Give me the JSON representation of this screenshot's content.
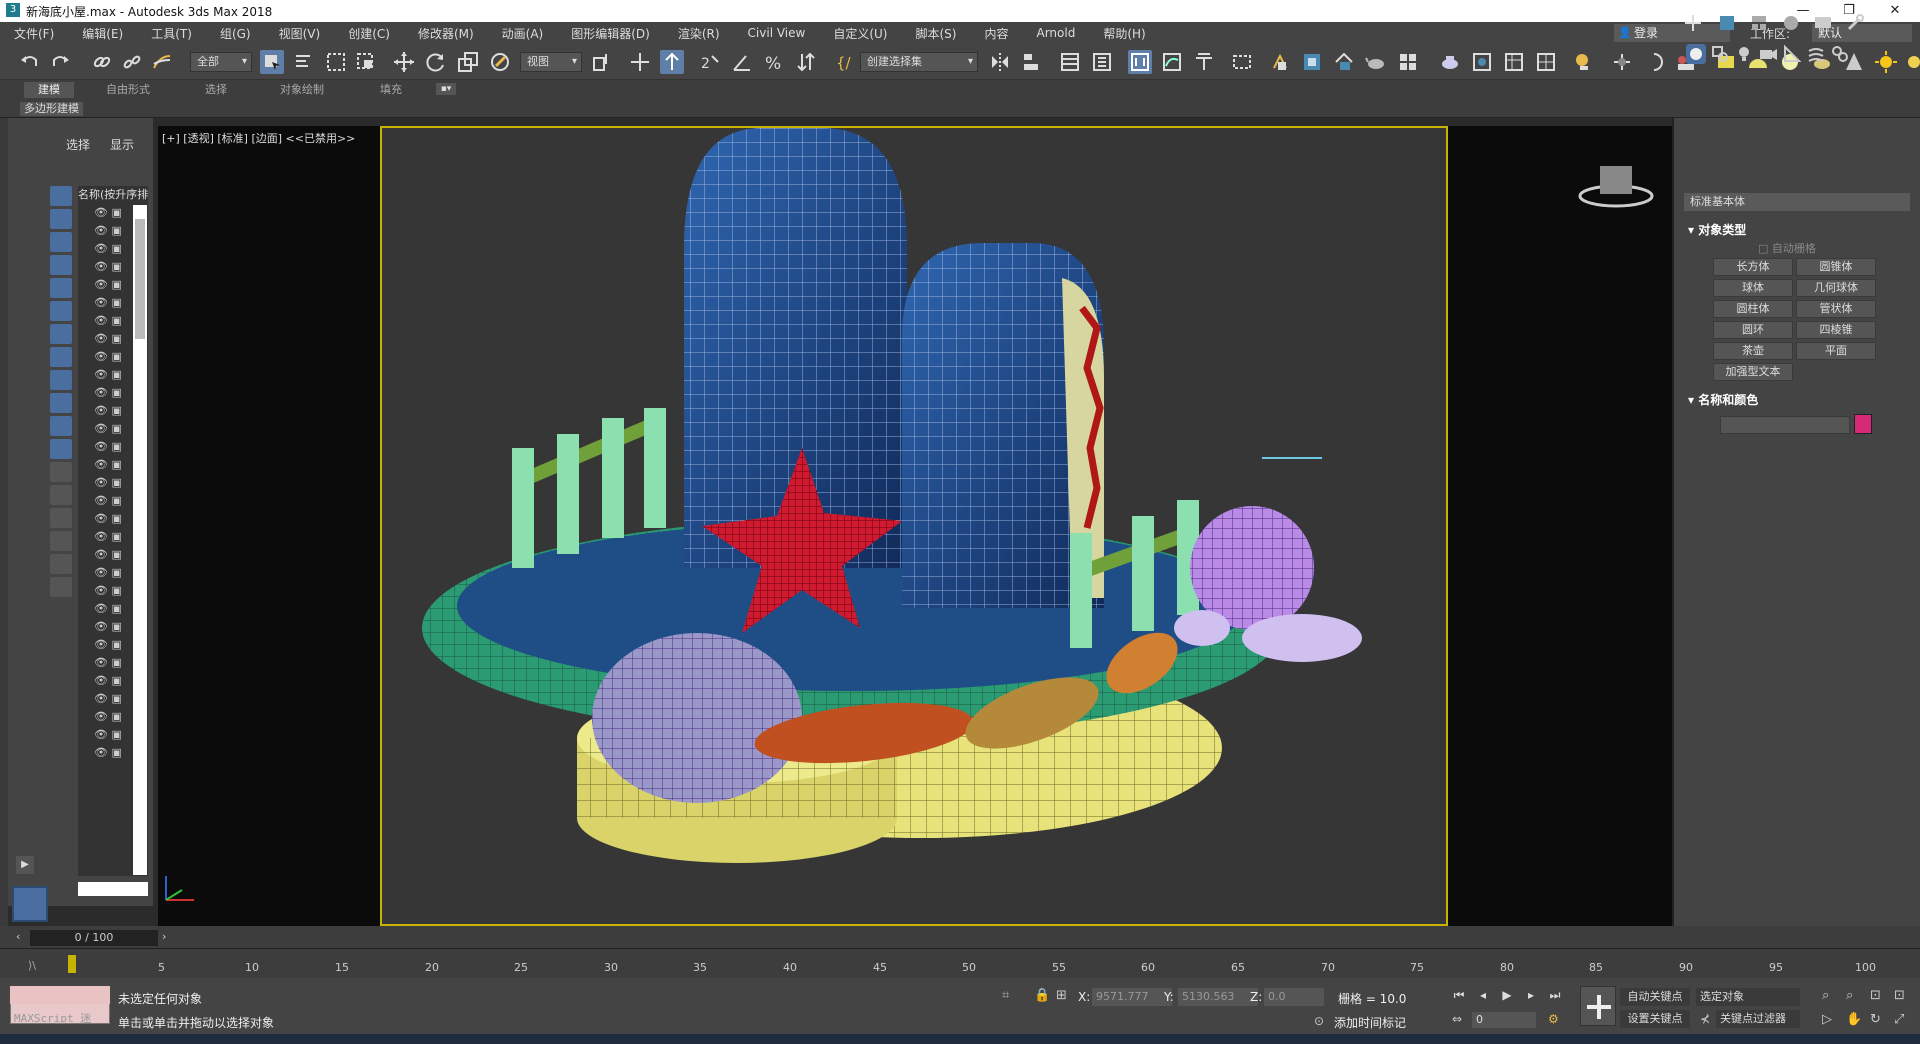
{
  "window": {
    "title": "新海底小屋.max - Autodesk 3ds Max 2018",
    "minimize": "—",
    "maximize": "❐",
    "close": "✕"
  },
  "menu": [
    "文件(F)",
    "编辑(E)",
    "工具(T)",
    "组(G)",
    "视图(V)",
    "创建(C)",
    "修改器(M)",
    "动画(A)",
    "图形编辑器(D)",
    "渲染(R)",
    "Civil View",
    "自定义(U)",
    "脚本(S)",
    "内容",
    "Arnold",
    "帮助(H)"
  ],
  "account": {
    "login": "登录",
    "workspace_label": "工作区:",
    "workspace_value": "默认"
  },
  "toolbar": {
    "selection_filter": "全部",
    "coord_system": "视图",
    "named_selection": "创建选择集"
  },
  "ribbon": {
    "tabs": [
      "建模",
      "自由形式",
      "选择",
      "对象绘制",
      "填充"
    ],
    "sub_label": "多边形建模"
  },
  "scene_explorer": {
    "tab_select": "选择",
    "tab_display": "显示",
    "column_header": "名称(按升序排",
    "row_count": 31
  },
  "viewport": {
    "label": "[+] [透视] [标准] [边面] <<已禁用>>"
  },
  "command_panel": {
    "dropdown": "标准基本体",
    "section_object_type": "对象类型",
    "autogrid": "自动栅格",
    "buttons": [
      "长方体",
      "圆锥体",
      "球体",
      "几何球体",
      "圆柱体",
      "管状体",
      "圆环",
      "四棱锥",
      "茶壶",
      "平面",
      "加强型文本"
    ],
    "section_name_color": "名称和颜色",
    "object_color": "#d62a76"
  },
  "timeline": {
    "frame_display": "0 / 100",
    "ticks": [
      "5",
      "10",
      "15",
      "20",
      "25",
      "30",
      "35",
      "40",
      "45",
      "50",
      "55",
      "60",
      "65",
      "70",
      "75",
      "80",
      "85",
      "90",
      "95",
      "100"
    ]
  },
  "status": {
    "maxscript": "MAXScript 迷",
    "line1": "未选定任何对象",
    "line2": "单击或单击并拖动以选择对象",
    "x_label": "X:",
    "x_value": "9571.777",
    "y_label": "Y:",
    "y_value": "5130.563",
    "z_label": "Z:",
    "z_value": "0.0",
    "grid": "栅格 = 10.0",
    "add_time_tag": "添加时间标记",
    "auto_key": "自动关键点",
    "set_key": "设置关键点",
    "selected_object": "选定对象",
    "key_filters": "关键点过滤器",
    "current_frame": "0"
  }
}
